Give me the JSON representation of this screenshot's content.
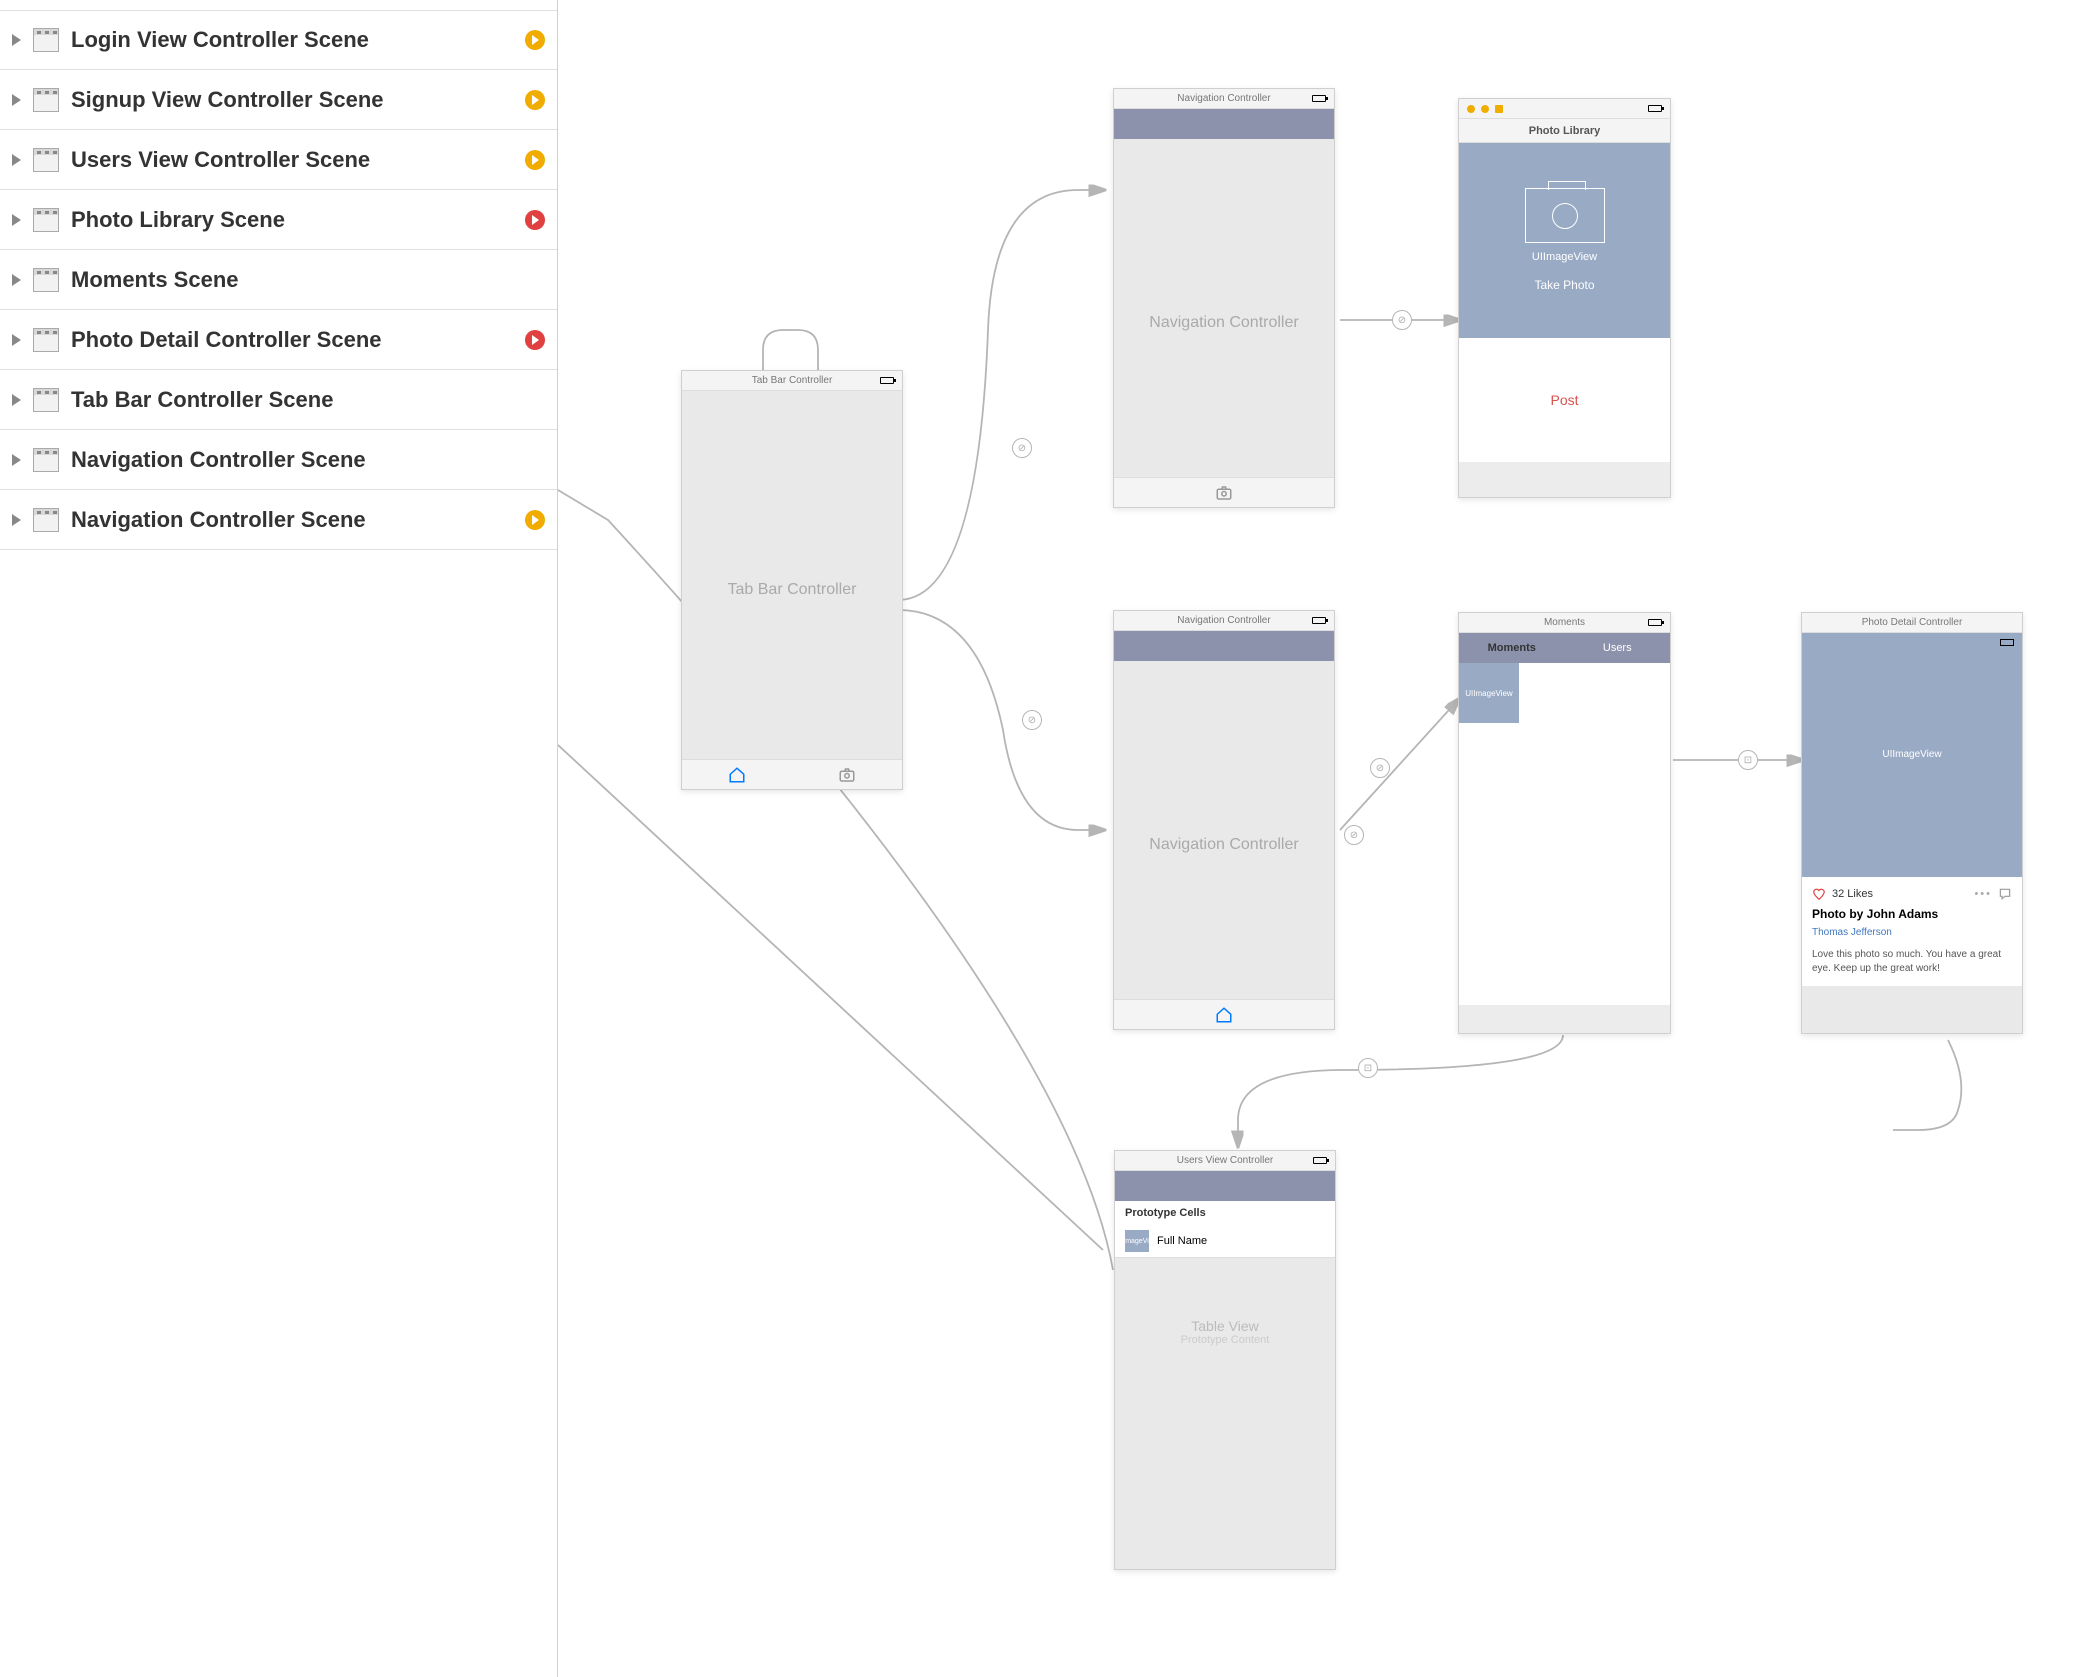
{
  "sidebar": {
    "items": [
      {
        "label": "Login View Controller Scene",
        "status": "yellow"
      },
      {
        "label": "Signup View Controller Scene",
        "status": "yellow"
      },
      {
        "label": "Users View Controller Scene",
        "status": "yellow"
      },
      {
        "label": "Photo Library Scene",
        "status": "red"
      },
      {
        "label": "Moments Scene",
        "status": ""
      },
      {
        "label": "Photo Detail Controller Scene",
        "status": "red"
      },
      {
        "label": "Tab Bar Controller Scene",
        "status": ""
      },
      {
        "label": "Navigation Controller Scene",
        "status": ""
      },
      {
        "label": "Navigation Controller Scene",
        "status": "yellow"
      }
    ]
  },
  "scenes": {
    "tabbar": {
      "header": "Tab Bar Controller",
      "body": "Tab Bar Controller"
    },
    "nav1": {
      "header": "Navigation Controller",
      "body": "Navigation Controller"
    },
    "nav2": {
      "header": "Navigation Controller",
      "body": "Navigation Controller"
    },
    "photoLibrary": {
      "title": "Photo Library",
      "imageView": "UIImageView",
      "takePhoto": "Take Photo",
      "post": "Post"
    },
    "moments": {
      "header": "Moments",
      "tab1": "Moments",
      "tab2": "Users",
      "thumb": "UIImageView"
    },
    "photoDetail": {
      "header": "Photo Detail Controller",
      "imageView": "UIImageView",
      "likes": "32 Likes",
      "title": "Photo by John Adams",
      "author": "Thomas Jefferson",
      "comment": "Love this photo so much. You have a great eye. Keep up the great work!"
    },
    "users": {
      "header": "Users View Controller",
      "prototype": "Prototype Cells",
      "cellImg": "UIImageView",
      "cellName": "Full Name",
      "tvLabel": "Table View",
      "tvSub": "Prototype Content"
    }
  }
}
